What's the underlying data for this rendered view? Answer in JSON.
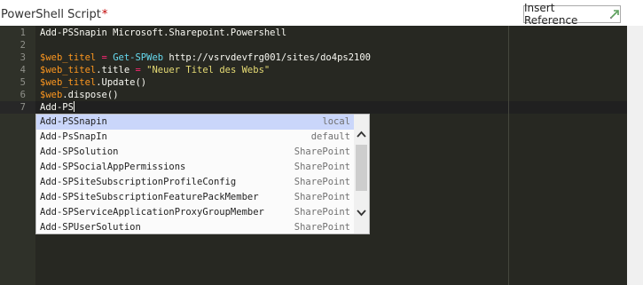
{
  "field": {
    "label": "PowerShell Script",
    "required_marker": "*"
  },
  "insert_reference": {
    "label": "Insert Reference"
  },
  "editor": {
    "line_numbers": [
      "1",
      "2",
      "3",
      "4",
      "5",
      "6",
      "7"
    ],
    "lines": [
      [
        {
          "t": "plain",
          "v": "Add-PSSnapin Microsoft.Sharepoint.Powershell"
        }
      ],
      [],
      [
        {
          "t": "var",
          "v": "$web_titel"
        },
        {
          "t": "plain",
          "v": " "
        },
        {
          "t": "op",
          "v": "="
        },
        {
          "t": "plain",
          "v": " "
        },
        {
          "t": "fn",
          "v": "Get-SPWeb"
        },
        {
          "t": "plain",
          "v": " http://vsrvdevfrg001/sites/do4ps2100"
        }
      ],
      [
        {
          "t": "var",
          "v": "$web_titel"
        },
        {
          "t": "plain",
          "v": ".title "
        },
        {
          "t": "op",
          "v": "="
        },
        {
          "t": "plain",
          "v": " "
        },
        {
          "t": "str",
          "v": "\"Neuer Titel des Webs\""
        }
      ],
      [
        {
          "t": "var",
          "v": "$web_titel"
        },
        {
          "t": "plain",
          "v": ".Update()"
        }
      ],
      [
        {
          "t": "var",
          "v": "$web"
        },
        {
          "t": "plain",
          "v": ".dispose()"
        }
      ],
      [
        {
          "t": "plain",
          "v": "Add-PS"
        }
      ]
    ]
  },
  "autocomplete": {
    "items": [
      {
        "name": "Add-PSSnapin",
        "meta": "local",
        "selected": true
      },
      {
        "name": "Add-PsSnapIn",
        "meta": "default",
        "selected": false
      },
      {
        "name": "Add-SPSolution",
        "meta": "SharePoint",
        "selected": false
      },
      {
        "name": "Add-SPSocialAppPermissions",
        "meta": "SharePoint",
        "selected": false
      },
      {
        "name": "Add-SPSiteSubscriptionProfileConfig",
        "meta": "SharePoint",
        "selected": false
      },
      {
        "name": "Add-SPSiteSubscriptionFeaturePackMember",
        "meta": "SharePoint",
        "selected": false
      },
      {
        "name": "Add-SPServiceApplicationProxyGroupMember",
        "meta": "SharePoint",
        "selected": false
      },
      {
        "name": "Add-SPUserSolution",
        "meta": "SharePoint",
        "selected": false
      }
    ]
  },
  "colors": {
    "editor_bg": "#272822",
    "variable": "#fd971f",
    "operator": "#f92672",
    "function": "#66d9ef",
    "string": "#e6db74",
    "selected_item": "#cad6fa"
  },
  "icons": [
    "external-link-icon",
    "chevron-up-icon",
    "chevron-down-icon"
  ]
}
